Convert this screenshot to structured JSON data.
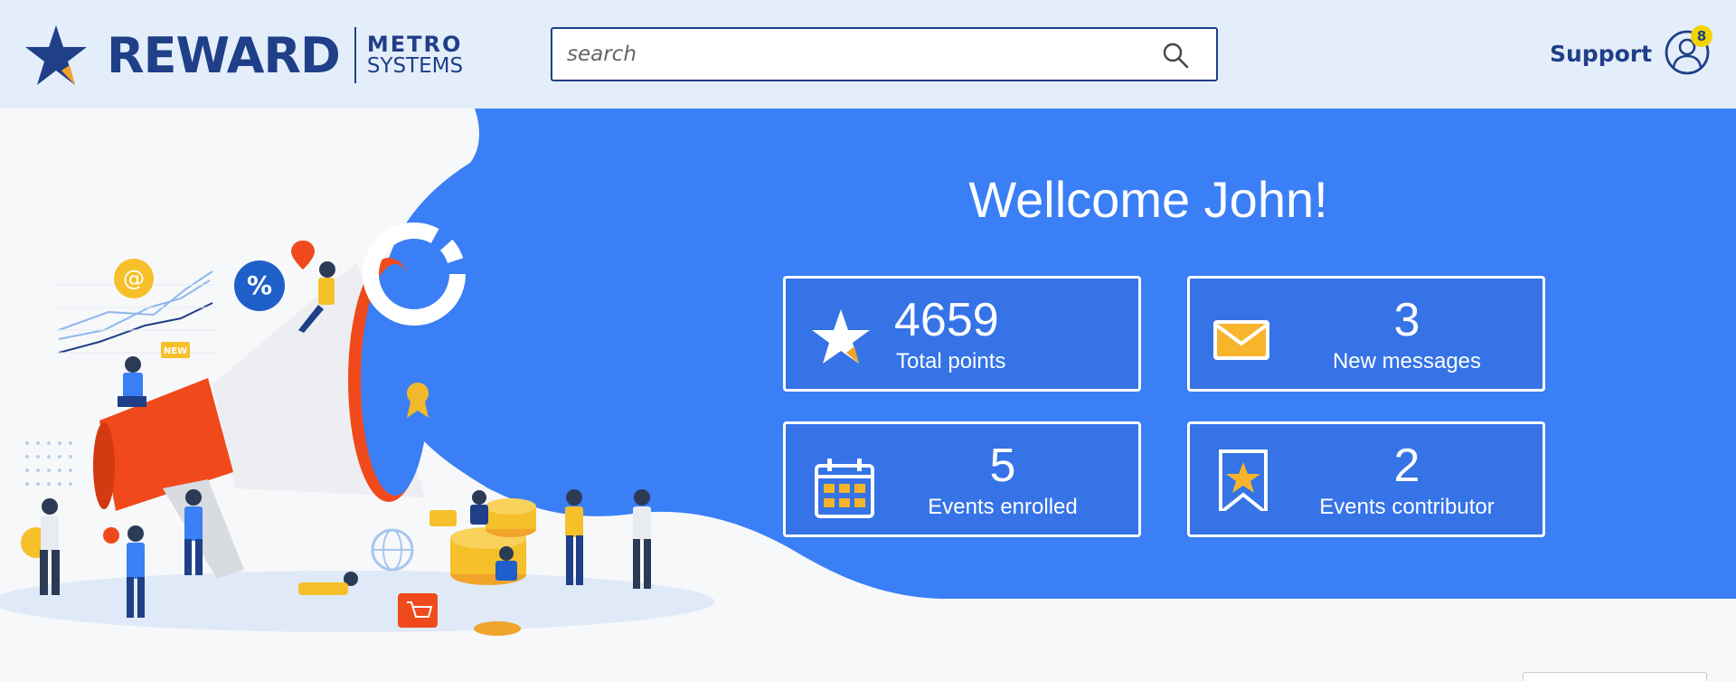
{
  "header": {
    "logo_main": "REWARD",
    "logo_metro": "METRO",
    "logo_systems": "SYSTEMS",
    "search_placeholder": "search",
    "support_label": "Support",
    "notification_count": "8"
  },
  "hero": {
    "welcome": "Wellcome John!",
    "cards": [
      {
        "value": "4659",
        "label": "Total points",
        "icon": "star-icon"
      },
      {
        "value": "3",
        "label": "New messages",
        "icon": "envelope-icon"
      },
      {
        "value": "5",
        "label": "Events enrolled",
        "icon": "calendar-icon"
      },
      {
        "value": "2",
        "label": "Events contributor",
        "icon": "bookmark-star-icon"
      }
    ],
    "illustration": {
      "badge_new": "NEW"
    }
  },
  "colors": {
    "brand_navy": "#1f3f88",
    "hero_blue": "#3a7ff6",
    "card_blue": "#3573e6",
    "accent_orange": "#f0a42a",
    "megaphone_red": "#f04a1c",
    "badge_yellow": "#f4d500"
  }
}
